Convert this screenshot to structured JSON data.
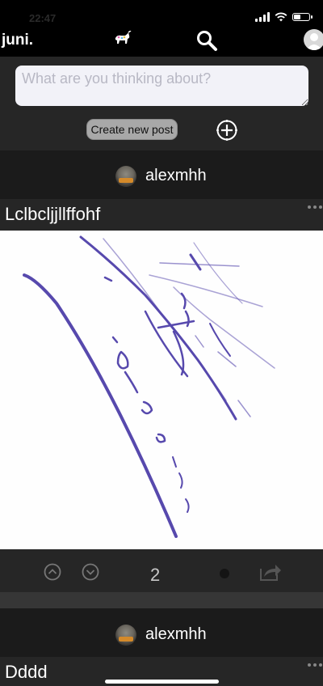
{
  "status_bar": {
    "time": "22:47"
  },
  "nav": {
    "brand": "juni."
  },
  "composer": {
    "placeholder": "What are you thinking about?",
    "create_post_label": "Create new post"
  },
  "posts": [
    {
      "author": "alexmhh",
      "title": "Lclbcljjllffohf",
      "vote_count": "2"
    },
    {
      "author": "alexmhh",
      "title": "Dddd"
    }
  ],
  "colors": {
    "background": "#000000",
    "panel": "#262626",
    "header_panel": "#1b1b1b",
    "input_bg": "#f2f2f8",
    "button_bg": "#a8a8a8",
    "ink": "#3a2aa0"
  }
}
